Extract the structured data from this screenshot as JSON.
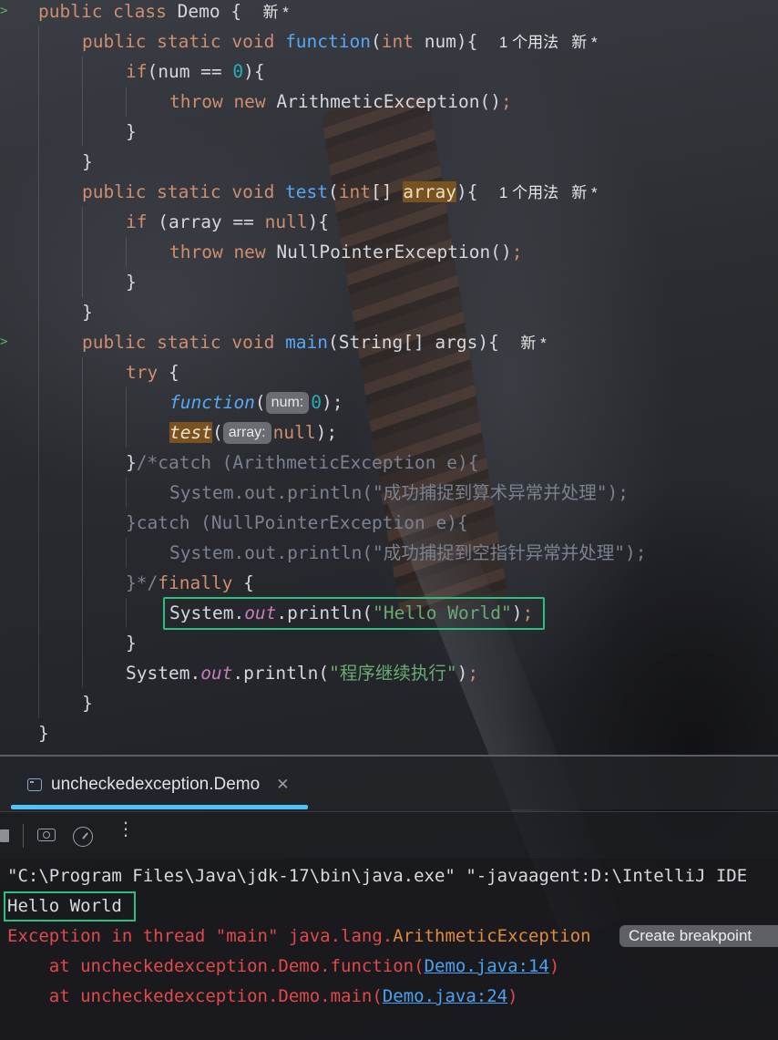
{
  "editor": {
    "lines": [
      {
        "parts": [
          [
            "kw",
            "public class "
          ],
          [
            "",
            "Demo {  "
          ],
          [
            "hint",
            "新 *"
          ]
        ]
      },
      {
        "parts": [
          [
            "kw",
            "public static void "
          ],
          [
            "fn",
            "function"
          ],
          [
            "",
            "("
          ],
          [
            "kw",
            "int "
          ],
          [
            "",
            "num){  "
          ],
          [
            "hint",
            "1 个用法   新 *"
          ]
        ]
      },
      {
        "parts": [
          [
            "kw",
            "if"
          ],
          [
            "",
            "(num == "
          ],
          [
            "num",
            "0"
          ],
          [
            "",
            "){"
          ]
        ]
      },
      {
        "parts": [
          [
            "kw",
            "throw new "
          ],
          [
            "",
            "ArithmeticException()"
          ],
          [
            "kw",
            ";"
          ]
        ]
      },
      {
        "parts": [
          [
            "",
            "}"
          ]
        ]
      },
      {
        "parts": [
          [
            "",
            "}"
          ]
        ]
      },
      {
        "parts": [
          [
            "kw",
            "public static void "
          ],
          [
            "fn",
            "test"
          ],
          [
            "",
            "("
          ],
          [
            "kw",
            "int"
          ],
          [
            "",
            "[] "
          ],
          [
            "hl",
            "array"
          ],
          [
            "",
            "){  "
          ],
          [
            "hint",
            "1 个用法   新 *"
          ]
        ]
      },
      {
        "parts": [
          [
            "kw",
            "if "
          ],
          [
            "",
            "(array == "
          ],
          [
            "kw",
            "null"
          ],
          [
            "",
            "){"
          ]
        ]
      },
      {
        "parts": [
          [
            "kw",
            "throw new "
          ],
          [
            "",
            "NullPointerException()"
          ],
          [
            "kw",
            ";"
          ]
        ]
      },
      {
        "parts": [
          [
            "",
            "}"
          ]
        ]
      },
      {
        "parts": [
          [
            "",
            "}"
          ]
        ]
      },
      {
        "parts": [
          [
            "kw",
            "public static void "
          ],
          [
            "fn",
            "main"
          ],
          [
            "",
            "(String[] args){  "
          ],
          [
            "hint",
            "新 *"
          ]
        ]
      },
      {
        "parts": [
          [
            "kw",
            "try "
          ],
          [
            "",
            "{"
          ]
        ]
      },
      {
        "parts": [
          [
            "it",
            "function"
          ],
          [
            "",
            "("
          ],
          [
            "param",
            "num:"
          ],
          [
            "num",
            "0"
          ],
          [
            "",
            "); "
          ]
        ]
      },
      {
        "parts": [
          [
            "hlit",
            "test"
          ],
          [
            "",
            "("
          ],
          [
            "param",
            "array:"
          ],
          [
            "kw",
            "null"
          ],
          [
            "",
            ");"
          ]
        ]
      },
      {
        "parts": [
          [
            "",
            "}"
          ],
          [
            "cm",
            "/*catch (ArithmeticException e){"
          ]
        ]
      },
      {
        "parts": [
          [
            "cm",
            "System.out.println(\"成功捕捉到算术异常并处理\");"
          ]
        ]
      },
      {
        "parts": [
          [
            "cm",
            "}catch (NullPointerException e){"
          ]
        ]
      },
      {
        "parts": [
          [
            "cm",
            "System.out.println(\"成功捕捉到空指针异常并处理\");"
          ]
        ]
      },
      {
        "parts": [
          [
            "cm",
            "}*/"
          ],
          [
            "kw",
            "finally "
          ],
          [
            "",
            "{"
          ]
        ]
      },
      {
        "parts": [
          [
            "",
            "System."
          ],
          [
            "fld",
            "out"
          ],
          [
            "",
            ".println("
          ],
          [
            "str",
            "\"Hello World\""
          ],
          [
            "",
            ")"
          ],
          [
            "kw",
            ";"
          ]
        ]
      },
      {
        "parts": [
          [
            "",
            "}"
          ]
        ]
      },
      {
        "parts": [
          [
            "",
            "System."
          ],
          [
            "fld",
            "out"
          ],
          [
            "",
            ".println("
          ],
          [
            "str",
            "\"程序继续执行\""
          ],
          [
            "",
            ")"
          ],
          [
            "kw",
            ";"
          ]
        ]
      },
      {
        "parts": [
          [
            "",
            "}"
          ]
        ]
      },
      {
        "parts": [
          [
            "",
            "}"
          ]
        ]
      }
    ]
  },
  "run_panel": {
    "tab_label": "uncheckedexception.Demo",
    "tab_close": "✕",
    "more_label": "⋮",
    "console": {
      "command": "\"C:\\Program Files\\Java\\jdk-17\\bin\\java.exe\" \"-javaagent:D:\\IntelliJ IDE",
      "output": "Hello World",
      "exception_prefix": "Exception in thread \"main\" java.lang.",
      "exception_class": "ArithmeticException",
      "tooltip": "Create breakpoint",
      "trace": [
        {
          "prefix": "    at uncheckedexception.Demo.function(",
          "link": "Demo.java:14",
          "suffix": ")"
        },
        {
          "prefix": "    at uncheckedexception.Demo.main(",
          "link": "Demo.java:24",
          "suffix": ")"
        }
      ]
    }
  }
}
